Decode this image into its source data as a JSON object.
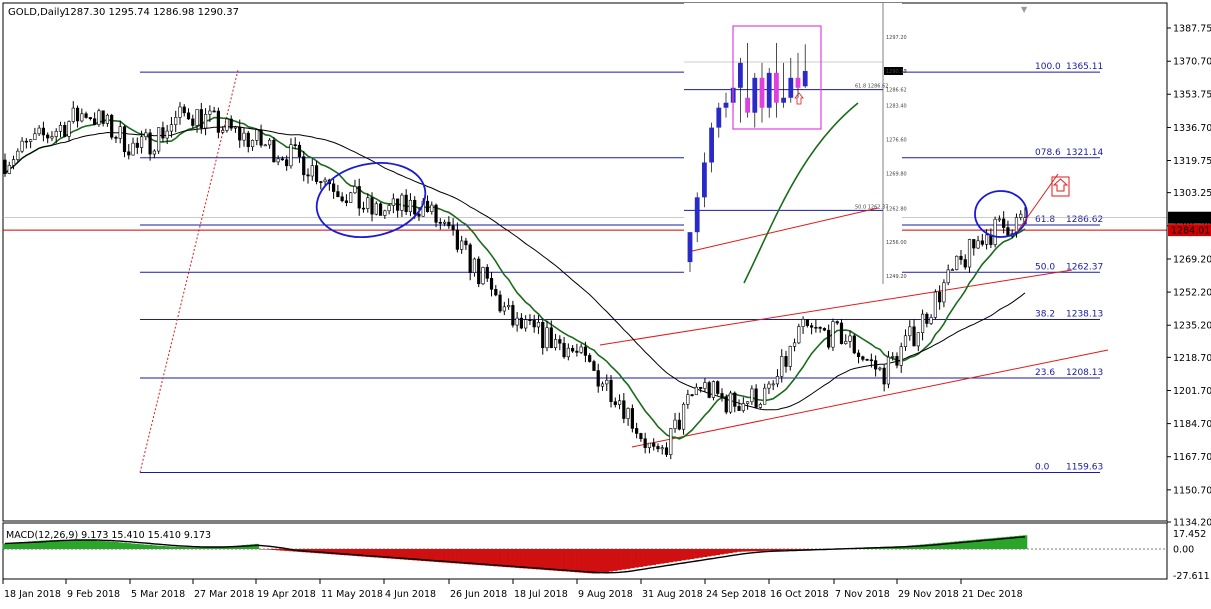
{
  "header": {
    "symbol": "GOLD,Daily",
    "ohlc": "1287.30 1295.74 1286.98 1290.37",
    "menu_arrow": "▼"
  },
  "colors": {
    "bull": "#1e1e1e",
    "bear": "#1e1e1e",
    "ma_fast": "#1a6b1a",
    "ma_slow": "#000000",
    "fib": "#1a1aa6",
    "channel": "#e01a1a",
    "ellipse": "#1a1ad6",
    "inset_box": "#e040e0",
    "inset_bull": "#2a2ac8",
    "inset_bear": "#e040e0",
    "price_tag_bg": "#000000",
    "support_tag_bg": "#d00000"
  },
  "price_axis": {
    "labels": [
      "1387.75",
      "1370.70",
      "1353.75",
      "1336.70",
      "1319.75",
      "1303.25",
      "1286.20",
      "1269.20",
      "1252.20",
      "1235.20",
      "1218.70",
      "1201.70",
      "1184.70",
      "1167.70",
      "1150.70",
      "1134.20"
    ],
    "current": "1290.37",
    "support": "1284.01"
  },
  "time_axis": {
    "labels": [
      "18 Jan 2018",
      "9 Feb 2018",
      "5 Mar 2018",
      "27 Mar 2018",
      "19 Apr 2018",
      "11 May 2018",
      "4 Jun 2018",
      "26 Jun 2018",
      "18 Jul 2018",
      "9 Aug 2018",
      "31 Aug 2018",
      "24 Sep 2018",
      "16 Oct 2018",
      "7 Nov 2018",
      "29 Nov 2018",
      "21 Dec 2018"
    ]
  },
  "fib_levels": [
    {
      "ratio": "100.0",
      "price": "1365.11",
      "value": 1365.11
    },
    {
      "ratio": "078.6",
      "price": "1321.14",
      "value": 1321.14
    },
    {
      "ratio": "61.8",
      "price": "1286.62",
      "value": 1286.62
    },
    {
      "ratio": "50.0",
      "price": "1262.37",
      "value": 1262.37
    },
    {
      "ratio": "38.2",
      "price": "1238.13",
      "value": 1238.13
    },
    {
      "ratio": "23.6",
      "price": "1208.13",
      "value": 1208.13
    },
    {
      "ratio": "0.0",
      "price": "1159.63",
      "value": 1159.63
    }
  ],
  "macd": {
    "label": "MACD(12,26,9) 9.173 15.410 15.410 9.173",
    "axis_labels": [
      "17.452",
      "0.00",
      "-27.611"
    ]
  },
  "inset": {
    "price_labels": [
      "1297.20",
      "1290.40",
      "1286.62",
      "1283.40",
      "1276.60",
      "1269.80",
      "1262.80",
      "1256.00",
      "1249.20"
    ],
    "current": "1290.37",
    "fib_labels": [
      "61.8  1286.62",
      "50.0  1262.37"
    ]
  },
  "chart_data": {
    "type": "candlestick",
    "title": "GOLD,Daily",
    "ylim": [
      1134.2,
      1395
    ],
    "x_range": [
      "18 Jan 2018",
      "31 Dec 2018"
    ],
    "grid": false,
    "key_points": [
      {
        "date": "Jan 2018",
        "price": 1335
      },
      {
        "date": "Mar 2018",
        "price": 1320
      },
      {
        "date": "Apr 2018",
        "price": 1345
      },
      {
        "date": "May 2018",
        "price": 1292
      },
      {
        "date": "Jun 2018",
        "price": 1297
      },
      {
        "date": "Jul 2018",
        "price": 1230
      },
      {
        "date": "16 Aug 2018",
        "price": 1160
      },
      {
        "date": "Sep 2018",
        "price": 1198
      },
      {
        "date": "Oct 2018",
        "price": 1230
      },
      {
        "date": "Nov 2018",
        "price": 1205
      },
      {
        "date": "Dec 2018",
        "price": 1255
      },
      {
        "date": "31 Dec 2018",
        "price": 1290.37
      }
    ]
  }
}
